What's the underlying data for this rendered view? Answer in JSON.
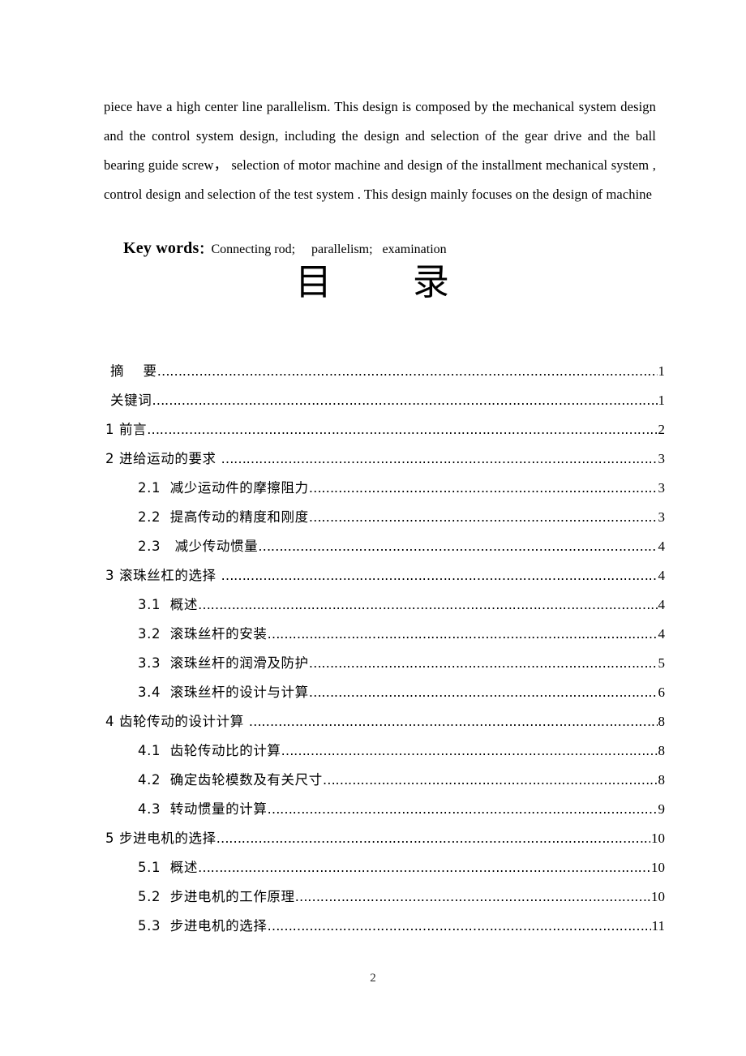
{
  "abstract": {
    "paragraph": "piece have a high center line parallelism. This design is composed by the mechanical system design and the control system design, including the design and selection of the gear drive and the ball bearing guide screw， selection of   motor machine and design of the installment mechanical system , control design and selection of the test system . This design mainly focuses on the design of machine"
  },
  "keywords": {
    "label": "Key words",
    "colon": "：",
    "value": "Connecting rod;     parallelism;   examination"
  },
  "toc": {
    "title": "目      录",
    "entries": [
      {
        "label": "摘    要",
        "page": "1",
        "level": 0
      },
      {
        "label": "关键词",
        "page": "1",
        "level": 0
      },
      {
        "label": "1 前言",
        "page": "2",
        "level": 1
      },
      {
        "label": "2 进给运动的要求 ",
        "page": "3",
        "level": 1
      },
      {
        "label": "2.1  减少运动件的摩擦阻力",
        "page": "3",
        "level": 2
      },
      {
        "label": "2.2  提高传动的精度和刚度",
        "page": "3",
        "level": 2
      },
      {
        "label": "2.3   减少传动惯量",
        "page": "4",
        "level": 2
      },
      {
        "label": "3 滚珠丝杠的选择 ",
        "page": "4",
        "level": 1
      },
      {
        "label": "3.1  概述",
        "page": "4",
        "level": 2
      },
      {
        "label": "3.2  滚珠丝杆的安装",
        "page": "4",
        "level": 2
      },
      {
        "label": "3.3  滚珠丝杆的润滑及防护",
        "page": "5",
        "level": 2
      },
      {
        "label": "3.4  滚珠丝杆的设计与计算",
        "page": "6",
        "level": 2
      },
      {
        "label": "4 齿轮传动的设计计算 ",
        "page": "8",
        "level": 1
      },
      {
        "label": "4.1  齿轮传动比的计算",
        "page": "8",
        "level": 2
      },
      {
        "label": "4.2  确定齿轮模数及有关尺寸",
        "page": "8",
        "level": 2
      },
      {
        "label": "4.3  转动惯量的计算",
        "page": "9",
        "level": 2
      },
      {
        "label": "5 步进电机的选择",
        "page": "10",
        "level": 1
      },
      {
        "label": "5.1  概述",
        "page": "10",
        "level": 2
      },
      {
        "label": "5.2  步进电机的工作原理",
        "page": "10",
        "level": 2
      },
      {
        "label": "5.3  步进电机的选择",
        "page": "11",
        "level": 2
      }
    ],
    "leader_char": "…"
  },
  "footer": {
    "page_number": "2"
  }
}
